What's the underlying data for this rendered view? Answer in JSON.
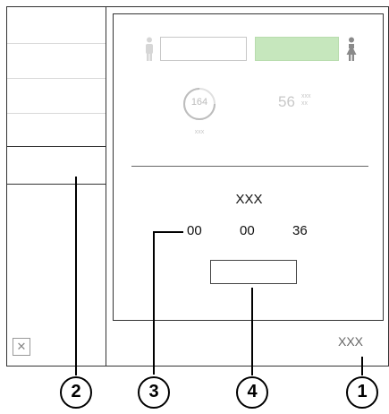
{
  "panel": {
    "gauge_value": "164",
    "gauge_label": "xxx",
    "big_value": "56",
    "unit_top": "xxx",
    "unit_bottom": "xx",
    "timer_label": "XXX",
    "time_values": [
      "00",
      "00",
      "36"
    ]
  },
  "footer_label": "XXX",
  "close_icon": "✕",
  "callouts": [
    "1",
    "2",
    "3",
    "4"
  ],
  "colors": {
    "accent_green": "#c6e7bd",
    "muted_text": "#c8c8c8"
  },
  "icons": [
    "male-person-icon",
    "female-person-icon",
    "close-icon"
  ]
}
